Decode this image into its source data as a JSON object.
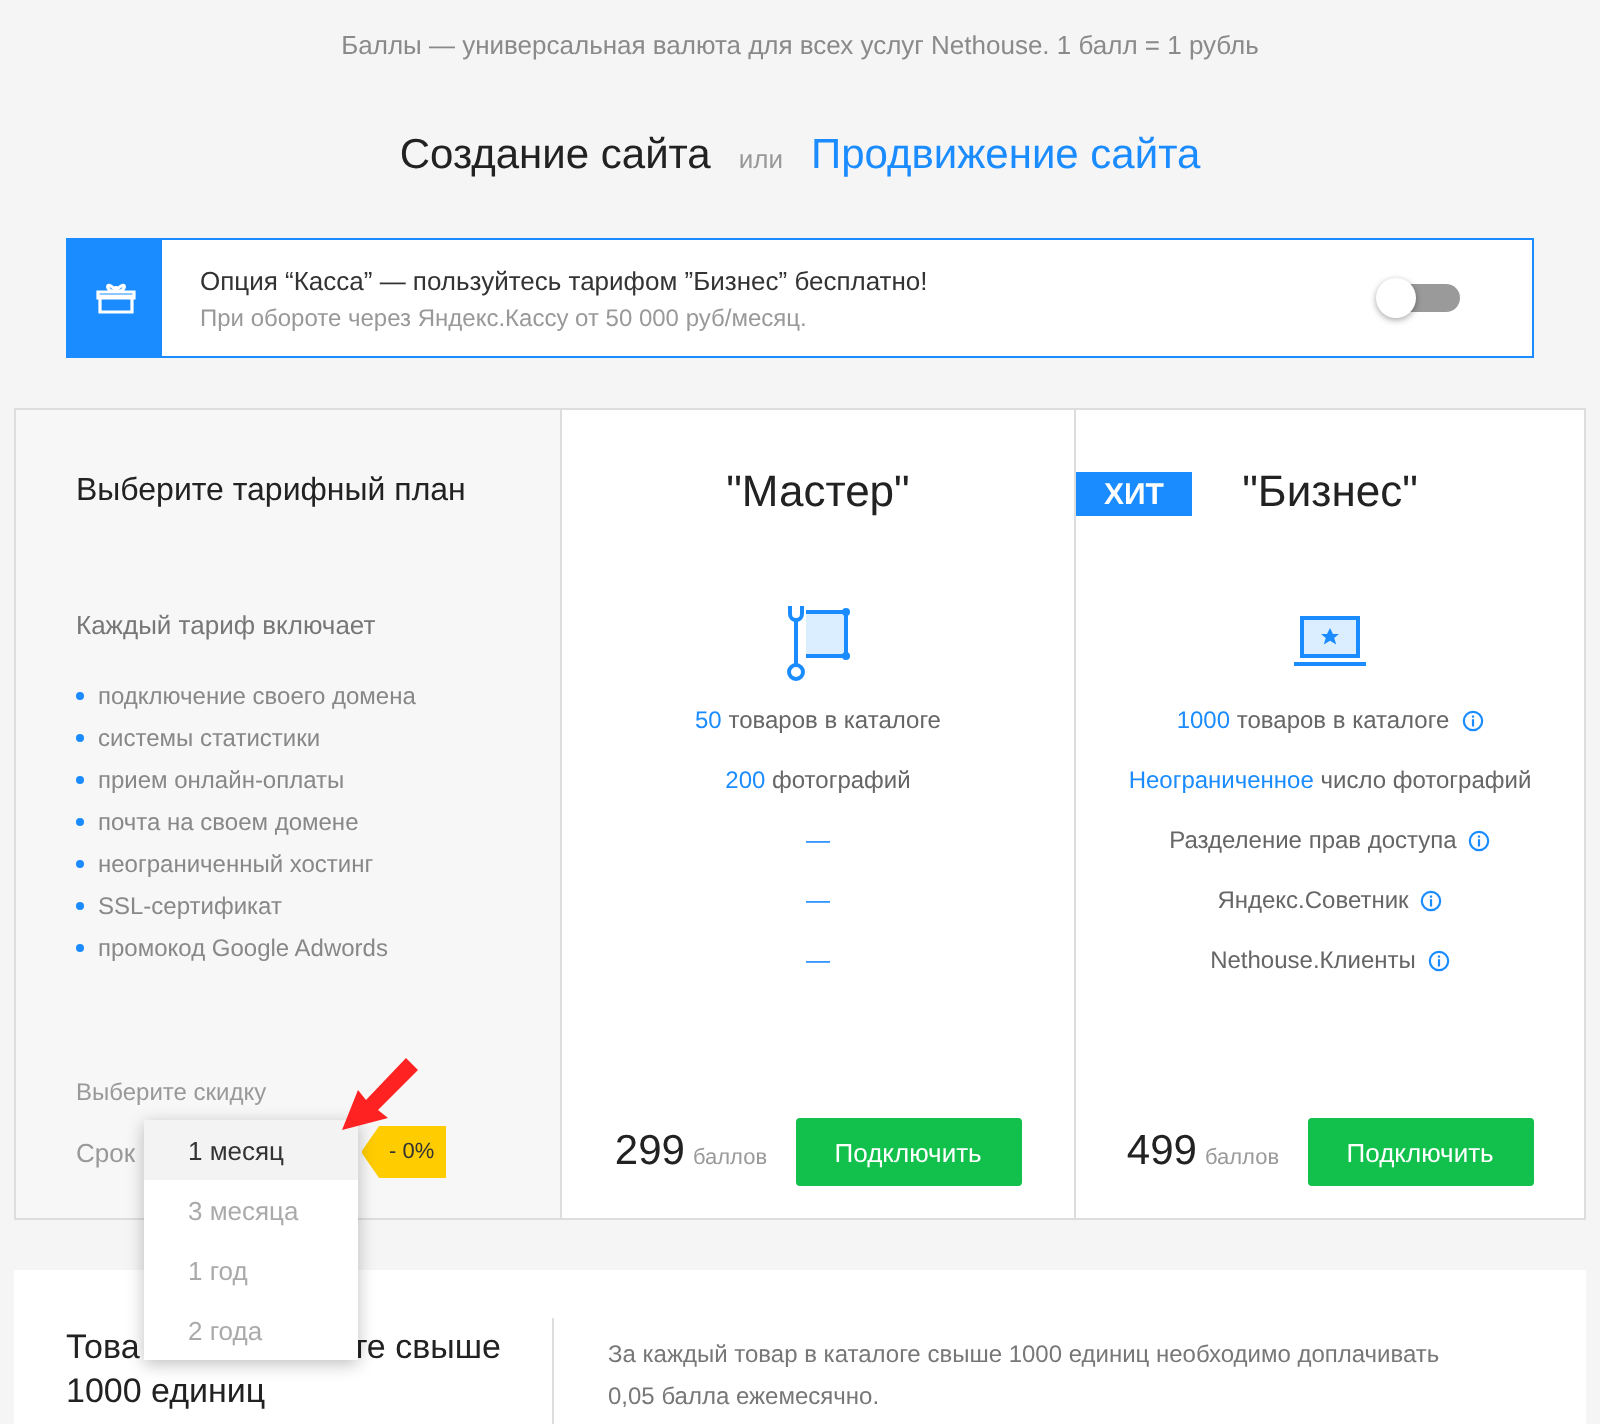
{
  "intro": "Баллы — универсальная валюта для всех услуг Nethouse. 1 балл = 1 рубль",
  "heading": {
    "primary": "Создание сайта",
    "separator": "или",
    "alternative": "Продвижение сайта"
  },
  "promo": {
    "title": "Опция “Касса” — пользуйтесь тарифом ”Бизнес” бесплатно!",
    "subtitle": "При обороте через Яндекс.Кассу от 50 000 руб/месяц.",
    "on": false
  },
  "plan_intro": {
    "title": "Выберите тарифный план",
    "includes_label": "Каждый тариф включает",
    "includes": [
      "подключение своего домена",
      "системы статистики",
      "прием онлайн-оплаты",
      "почта на своем домене",
      "неограниченный хостинг",
      "SSL-сертификат",
      "промокод Google Adwords"
    ],
    "discount_label": "Выберите скидку",
    "term_label": "Срок",
    "discount_badge": "- 0%",
    "term_options": [
      {
        "label": "1 месяц",
        "selected": true
      },
      {
        "label": "3 месяца",
        "selected": false
      },
      {
        "label": "1 год",
        "selected": false
      },
      {
        "label": "2 года",
        "selected": false
      }
    ]
  },
  "plans": [
    {
      "name": "\"Мастер\"",
      "features": [
        {
          "kind": "text",
          "highlight": "50",
          "text": "товаров в каталоге",
          "info": false
        },
        {
          "kind": "text",
          "highlight": "200",
          "text": "фотографий",
          "info": false
        },
        {
          "kind": "dash",
          "text": "—",
          "info": false
        },
        {
          "kind": "dash",
          "text": "—",
          "info": false
        },
        {
          "kind": "dash",
          "text": "—",
          "info": false
        }
      ],
      "price": "299",
      "unit": "баллов",
      "button": "Подключить"
    },
    {
      "name": "\"Бизнес\"",
      "badge": "ХИТ",
      "features": [
        {
          "kind": "text",
          "highlight": "1000",
          "text": "товаров в каталоге",
          "info": true
        },
        {
          "kind": "text",
          "highlight": "Неограниченное",
          "text": "число фотографий",
          "info": false
        },
        {
          "kind": "text",
          "text": "Разделение прав доступа",
          "info": true
        },
        {
          "kind": "text",
          "text": "Яндекс.Советник",
          "info": true
        },
        {
          "kind": "text",
          "text": "Nethouse.Клиенты",
          "info": true
        }
      ],
      "price": "499",
      "unit": "баллов",
      "button": "Подключить"
    }
  ],
  "extra": {
    "title_parts": [
      "Това",
      "те свыше"
    ],
    "title_line2": "1000 единиц",
    "note": "За каждый товар в каталоге свыше 1000 единиц необходимо доплачивать 0,05 балла ежемесячно."
  }
}
